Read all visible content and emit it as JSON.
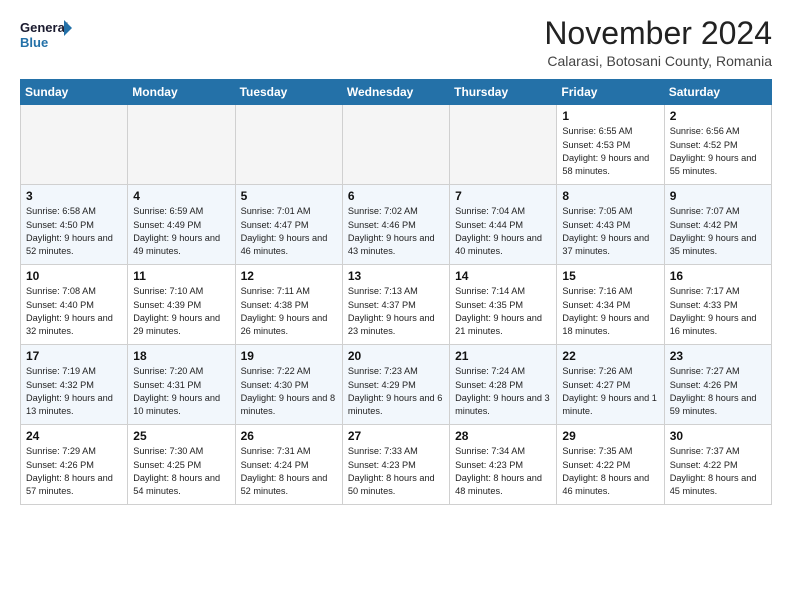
{
  "logo": {
    "line1": "General",
    "line2": "Blue"
  },
  "title": "November 2024",
  "location": "Calarasi, Botosani County, Romania",
  "weekdays": [
    "Sunday",
    "Monday",
    "Tuesday",
    "Wednesday",
    "Thursday",
    "Friday",
    "Saturday"
  ],
  "weeks": [
    [
      {
        "day": "",
        "info": ""
      },
      {
        "day": "",
        "info": ""
      },
      {
        "day": "",
        "info": ""
      },
      {
        "day": "",
        "info": ""
      },
      {
        "day": "",
        "info": ""
      },
      {
        "day": "1",
        "info": "Sunrise: 6:55 AM\nSunset: 4:53 PM\nDaylight: 9 hours\nand 58 minutes."
      },
      {
        "day": "2",
        "info": "Sunrise: 6:56 AM\nSunset: 4:52 PM\nDaylight: 9 hours\nand 55 minutes."
      }
    ],
    [
      {
        "day": "3",
        "info": "Sunrise: 6:58 AM\nSunset: 4:50 PM\nDaylight: 9 hours\nand 52 minutes."
      },
      {
        "day": "4",
        "info": "Sunrise: 6:59 AM\nSunset: 4:49 PM\nDaylight: 9 hours\nand 49 minutes."
      },
      {
        "day": "5",
        "info": "Sunrise: 7:01 AM\nSunset: 4:47 PM\nDaylight: 9 hours\nand 46 minutes."
      },
      {
        "day": "6",
        "info": "Sunrise: 7:02 AM\nSunset: 4:46 PM\nDaylight: 9 hours\nand 43 minutes."
      },
      {
        "day": "7",
        "info": "Sunrise: 7:04 AM\nSunset: 4:44 PM\nDaylight: 9 hours\nand 40 minutes."
      },
      {
        "day": "8",
        "info": "Sunrise: 7:05 AM\nSunset: 4:43 PM\nDaylight: 9 hours\nand 37 minutes."
      },
      {
        "day": "9",
        "info": "Sunrise: 7:07 AM\nSunset: 4:42 PM\nDaylight: 9 hours\nand 35 minutes."
      }
    ],
    [
      {
        "day": "10",
        "info": "Sunrise: 7:08 AM\nSunset: 4:40 PM\nDaylight: 9 hours\nand 32 minutes."
      },
      {
        "day": "11",
        "info": "Sunrise: 7:10 AM\nSunset: 4:39 PM\nDaylight: 9 hours\nand 29 minutes."
      },
      {
        "day": "12",
        "info": "Sunrise: 7:11 AM\nSunset: 4:38 PM\nDaylight: 9 hours\nand 26 minutes."
      },
      {
        "day": "13",
        "info": "Sunrise: 7:13 AM\nSunset: 4:37 PM\nDaylight: 9 hours\nand 23 minutes."
      },
      {
        "day": "14",
        "info": "Sunrise: 7:14 AM\nSunset: 4:35 PM\nDaylight: 9 hours\nand 21 minutes."
      },
      {
        "day": "15",
        "info": "Sunrise: 7:16 AM\nSunset: 4:34 PM\nDaylight: 9 hours\nand 18 minutes."
      },
      {
        "day": "16",
        "info": "Sunrise: 7:17 AM\nSunset: 4:33 PM\nDaylight: 9 hours\nand 16 minutes."
      }
    ],
    [
      {
        "day": "17",
        "info": "Sunrise: 7:19 AM\nSunset: 4:32 PM\nDaylight: 9 hours\nand 13 minutes."
      },
      {
        "day": "18",
        "info": "Sunrise: 7:20 AM\nSunset: 4:31 PM\nDaylight: 9 hours\nand 10 minutes."
      },
      {
        "day": "19",
        "info": "Sunrise: 7:22 AM\nSunset: 4:30 PM\nDaylight: 9 hours\nand 8 minutes."
      },
      {
        "day": "20",
        "info": "Sunrise: 7:23 AM\nSunset: 4:29 PM\nDaylight: 9 hours\nand 6 minutes."
      },
      {
        "day": "21",
        "info": "Sunrise: 7:24 AM\nSunset: 4:28 PM\nDaylight: 9 hours\nand 3 minutes."
      },
      {
        "day": "22",
        "info": "Sunrise: 7:26 AM\nSunset: 4:27 PM\nDaylight: 9 hours\nand 1 minute."
      },
      {
        "day": "23",
        "info": "Sunrise: 7:27 AM\nSunset: 4:26 PM\nDaylight: 8 hours\nand 59 minutes."
      }
    ],
    [
      {
        "day": "24",
        "info": "Sunrise: 7:29 AM\nSunset: 4:26 PM\nDaylight: 8 hours\nand 57 minutes."
      },
      {
        "day": "25",
        "info": "Sunrise: 7:30 AM\nSunset: 4:25 PM\nDaylight: 8 hours\nand 54 minutes."
      },
      {
        "day": "26",
        "info": "Sunrise: 7:31 AM\nSunset: 4:24 PM\nDaylight: 8 hours\nand 52 minutes."
      },
      {
        "day": "27",
        "info": "Sunrise: 7:33 AM\nSunset: 4:23 PM\nDaylight: 8 hours\nand 50 minutes."
      },
      {
        "day": "28",
        "info": "Sunrise: 7:34 AM\nSunset: 4:23 PM\nDaylight: 8 hours\nand 48 minutes."
      },
      {
        "day": "29",
        "info": "Sunrise: 7:35 AM\nSunset: 4:22 PM\nDaylight: 8 hours\nand 46 minutes."
      },
      {
        "day": "30",
        "info": "Sunrise: 7:37 AM\nSunset: 4:22 PM\nDaylight: 8 hours\nand 45 minutes."
      }
    ]
  ]
}
